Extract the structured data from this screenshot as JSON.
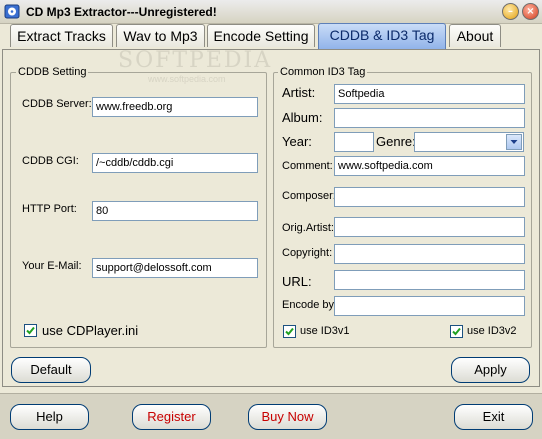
{
  "window": {
    "title": "CD Mp3 Extractor---Unregistered!"
  },
  "tabs": [
    "Extract Tracks",
    "Wav to Mp3",
    "Encode Setting",
    "CDDB & ID3 Tag",
    "About"
  ],
  "watermark": {
    "text": "SOFTPEDIA",
    "url": "www.softpedia.com"
  },
  "cddb": {
    "group_label": "CDDB Setting",
    "server_label": "CDDB Server:",
    "server_value": "www.freedb.org",
    "cgi_label": "CDDB CGI:",
    "cgi_value": "/~cddb/cddb.cgi",
    "port_label": "HTTP Port:",
    "port_value": "80",
    "email_label": "Your E-Mail:",
    "email_value": "support@delossoft.com",
    "cdplayer_label": "use CDPlayer.ini",
    "cdplayer_checked": true
  },
  "id3": {
    "group_label": "Common ID3 Tag",
    "artist_label": "Artist:",
    "artist_value": "Softpedia",
    "album_label": "Album:",
    "album_value": "",
    "year_label": "Year:",
    "year_value": "",
    "genre_label": "Genre:",
    "genre_value": "",
    "comment_label": "Comment:",
    "comment_value": "www.softpedia.com",
    "composer_label": "Composer:",
    "composer_value": "",
    "origartist_label": "Orig.Artist:",
    "origartist_value": "",
    "copyright_label": "Copyright:",
    "copyright_value": "",
    "url_label": "URL:",
    "url_value": "",
    "encodeby_label": "Encode by:",
    "encodeby_value": "",
    "id3v1_label": "use ID3v1",
    "id3v1_checked": true,
    "id3v2_label": "use ID3v2",
    "id3v2_checked": true
  },
  "buttons": {
    "default": "Default",
    "apply": "Apply",
    "help": "Help",
    "register": "Register",
    "buynow": "Buy Now",
    "exit": "Exit"
  }
}
